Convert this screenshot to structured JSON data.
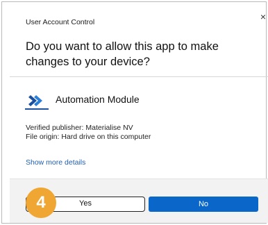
{
  "dialog": {
    "window_title": "User Account Control",
    "close_glyph": "×",
    "question": "Do you want to allow this app to make changes to your device?",
    "app": {
      "icon": "automation-module-icon",
      "name": "Automation Module"
    },
    "publisher": "Verified publisher: Materialise NV",
    "origin": "File origin: Hard drive on this computer",
    "details_link": "Show more details",
    "buttons": {
      "yes_label": "Yes",
      "no_label": "No"
    },
    "colors": {
      "accent": "#0a67c9",
      "badge": "#f0a632",
      "link": "#1f5fb0"
    }
  },
  "annotation": {
    "step_badge": "4"
  }
}
